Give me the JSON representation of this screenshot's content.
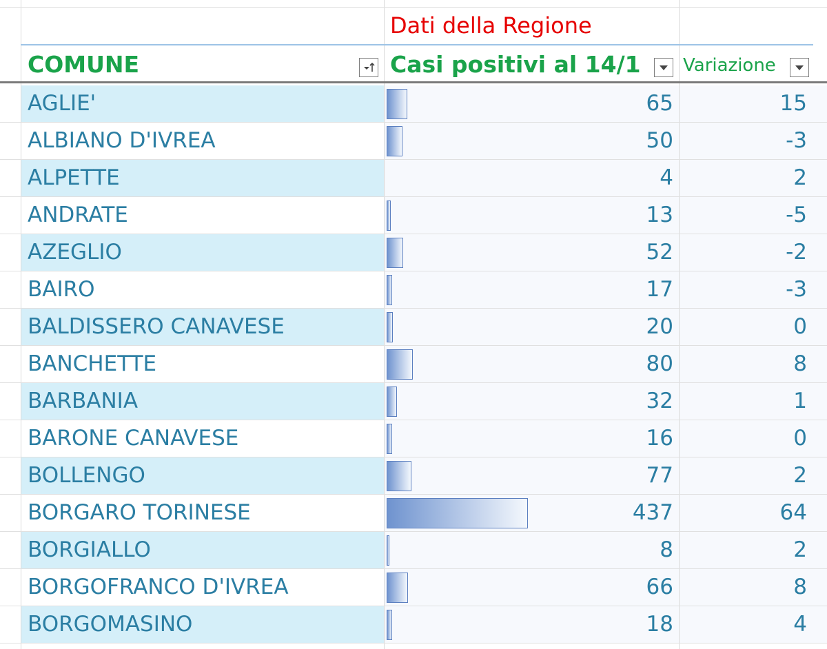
{
  "sheet": {
    "group_title": "Dati della Regione",
    "columns": [
      {
        "label": "COMUNE"
      },
      {
        "label": "Casi positivi al 14/1"
      },
      {
        "label": "Variazione"
      }
    ]
  },
  "bar_max": 437,
  "rows": [
    {
      "comune": "AGLIE'",
      "casi": 65,
      "variazione": 15
    },
    {
      "comune": "ALBIANO D'IVREA",
      "casi": 50,
      "variazione": -3
    },
    {
      "comune": "ALPETTE",
      "casi": 4,
      "variazione": 2
    },
    {
      "comune": "ANDRATE",
      "casi": 13,
      "variazione": -5
    },
    {
      "comune": "AZEGLIO",
      "casi": 52,
      "variazione": -2
    },
    {
      "comune": "BAIRO",
      "casi": 17,
      "variazione": -3
    },
    {
      "comune": "BALDISSERO CANAVESE",
      "casi": 20,
      "variazione": 0
    },
    {
      "comune": "BANCHETTE",
      "casi": 80,
      "variazione": 8
    },
    {
      "comune": "BARBANIA",
      "casi": 32,
      "variazione": 1
    },
    {
      "comune": "BARONE CANAVESE",
      "casi": 16,
      "variazione": 0
    },
    {
      "comune": "BOLLENGO",
      "casi": 77,
      "variazione": 2
    },
    {
      "comune": "BORGARO TORINESE",
      "casi": 437,
      "variazione": 64
    },
    {
      "comune": "BORGIALLO",
      "casi": 8,
      "variazione": 2
    },
    {
      "comune": "BORGOFRANCO D'IVREA",
      "casi": 66,
      "variazione": 8
    },
    {
      "comune": "BORGOMASINO",
      "casi": 18,
      "variazione": 4
    }
  ],
  "icons": {
    "sort_filter": "sort-filter-icon",
    "dropdown": "dropdown-arrow-icon"
  },
  "colors": {
    "title": "#e60000",
    "header": "#1aa34a",
    "row_text": "#2b7ea3",
    "band": "#d5eff9",
    "bar": "#6f93cf"
  }
}
